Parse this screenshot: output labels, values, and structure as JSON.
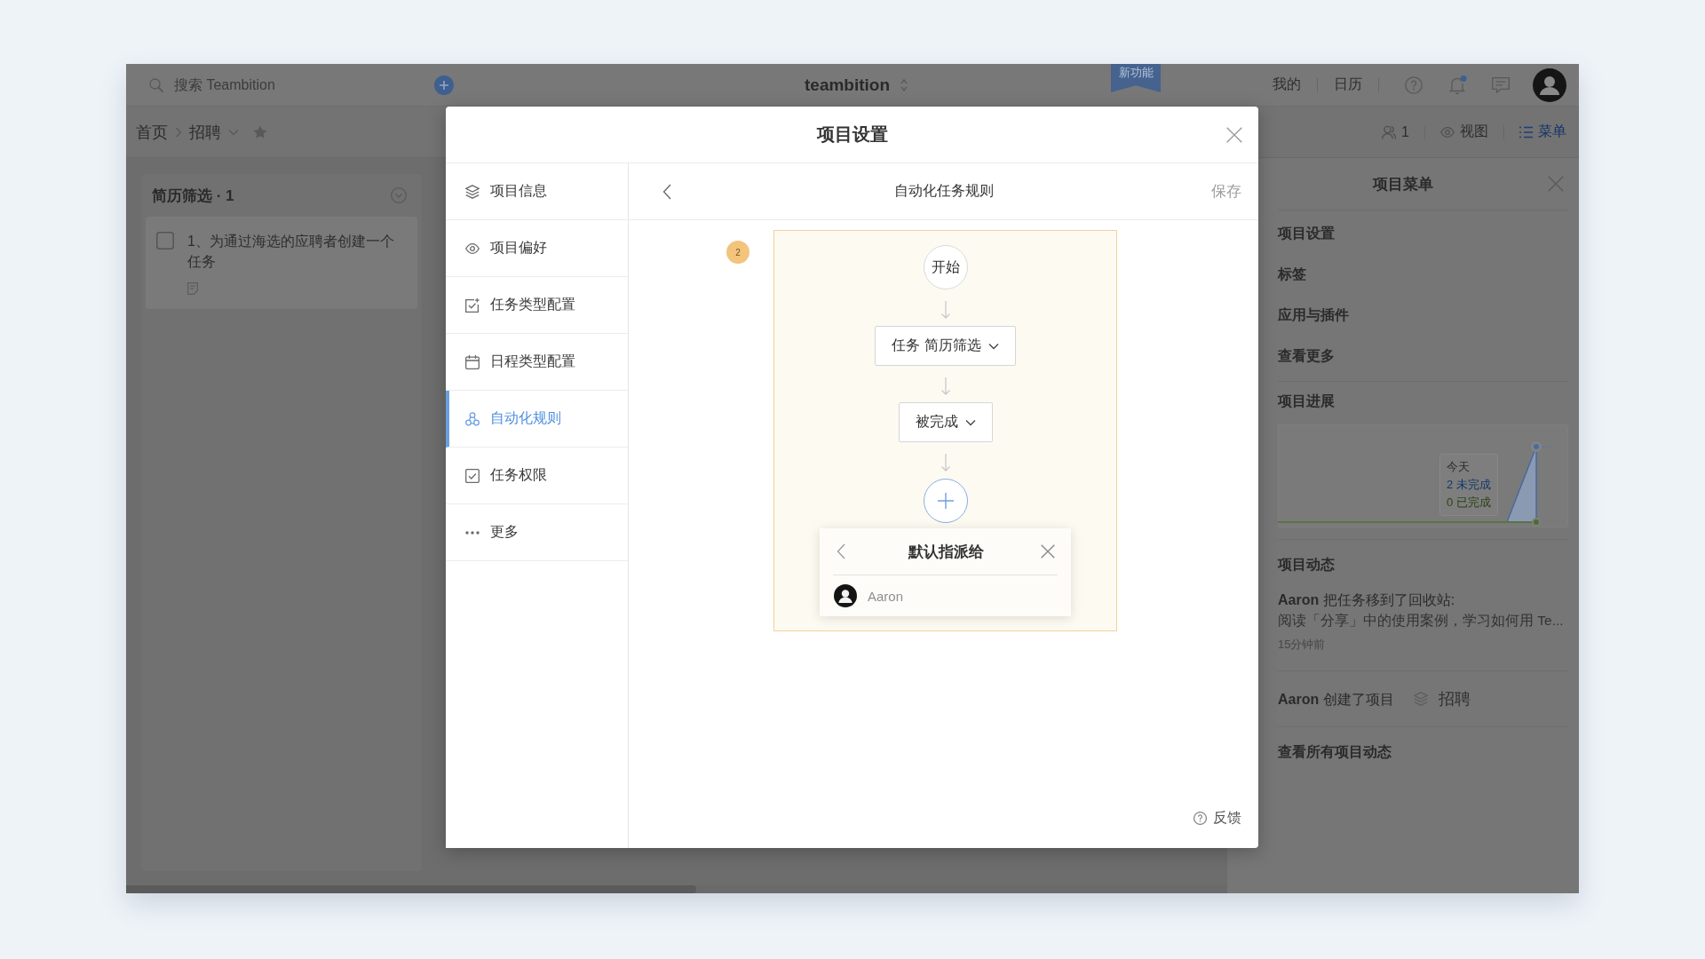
{
  "top_bar": {
    "search": {
      "placeholder": "搜索 Teambition"
    },
    "logo": "teambition",
    "ribbon": "新功能",
    "links": [
      {
        "label": "我的"
      },
      {
        "label": "日历"
      }
    ]
  },
  "breadcrumb": {
    "items": [
      {
        "label": "首页",
        "kind": "link"
      },
      {
        "label": "招聘",
        "kind": "dropdown"
      }
    ]
  },
  "toolbar": [
    {
      "kind": "members",
      "label": "1",
      "selected": false
    },
    {
      "kind": "view",
      "label": "视图",
      "selected": false
    },
    {
      "kind": "menu",
      "label": "菜单",
      "selected": true
    }
  ],
  "board": {
    "columns": [
      {
        "title": "简历筛选 · 1",
        "cards": [
          {
            "title": "1、为通过海选的应聘者创建一个任务",
            "checked": false
          }
        ]
      }
    ]
  },
  "menu_panel": {
    "title": "项目菜单",
    "items": [
      {
        "label": "项目设置"
      },
      {
        "label": "标签"
      },
      {
        "label": "应用与插件"
      },
      {
        "label": "查看更多"
      }
    ],
    "progress": {
      "title": "项目进展",
      "tooltip": {
        "date": "今天",
        "open": "2 未完成",
        "done": "0 已完成"
      }
    },
    "activity": {
      "title": "项目动态",
      "entries": [
        {
          "kind": "moved",
          "text": "**Aaron** 把任务移到了回收站:",
          "detail": "阅读「分享」中的使用案例，学习如何用 Te...",
          "time": "15分钟前"
        },
        {
          "kind": "created",
          "text": "**Aaron** 创建了项目",
          "project": "招聘"
        }
      ],
      "more": "查看所有项目动态"
    }
  },
  "dialog": {
    "title": "项目设置",
    "nav": [
      {
        "label": "项目信息",
        "selected": false
      },
      {
        "label": "项目偏好",
        "selected": false
      },
      {
        "label": "任务类型配置",
        "selected": false
      },
      {
        "label": "日程类型配置",
        "selected": false
      },
      {
        "label": "自动化规则",
        "selected": true
      },
      {
        "label": "任务权限",
        "selected": false
      },
      {
        "label": "更多",
        "selected": false
      }
    ],
    "panel": {
      "title": "自动化任务规则",
      "save": {
        "label": "保存",
        "disabled": true
      },
      "rule_badge": "2",
      "flow": {
        "start": "开始",
        "steps": [
          {
            "label": "任务 简历筛选"
          },
          {
            "label": "被完成"
          }
        ],
        "popup": {
          "title": "默认指派给",
          "members": [
            {
              "name": "Aaron"
            }
          ]
        }
      },
      "feedback": "反馈"
    }
  }
}
